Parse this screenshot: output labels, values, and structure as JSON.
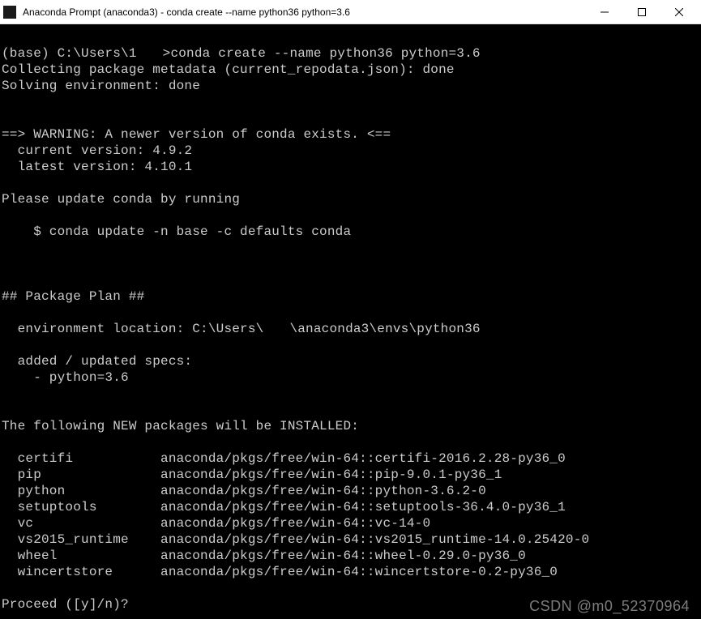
{
  "window": {
    "title": "Anaconda Prompt (anaconda3) - conda  create --name python36 python=3.6"
  },
  "prompt": {
    "prefix": "(base) C:\\Users\\1",
    "gt": ">",
    "command": "conda create --name python36 python=3.6"
  },
  "lines": {
    "collecting": "Collecting package metadata (current_repodata.json): done",
    "solving": "Solving environment: done",
    "warn_header": "==> WARNING: A newer version of conda exists. <==",
    "current_ver": "  current version: 4.9.2",
    "latest_ver": "  latest version: 4.10.1",
    "please_update": "Please update conda by running",
    "update_cmd": "    $ conda update -n base -c defaults conda",
    "plan_header": "## Package Plan ##",
    "env_loc_prefix": "  environment location: C:\\Users\\",
    "env_loc_suffix": "\\anaconda3\\envs\\python36",
    "added_specs": "  added / updated specs:",
    "spec1": "    - python=3.6",
    "new_pkg_header": "The following NEW packages will be INSTALLED:"
  },
  "packages": [
    {
      "name": "certifi",
      "spec": "anaconda/pkgs/free/win-64::certifi-2016.2.28-py36_0"
    },
    {
      "name": "pip",
      "spec": "anaconda/pkgs/free/win-64::pip-9.0.1-py36_1"
    },
    {
      "name": "python",
      "spec": "anaconda/pkgs/free/win-64::python-3.6.2-0"
    },
    {
      "name": "setuptools",
      "spec": "anaconda/pkgs/free/win-64::setuptools-36.4.0-py36_1"
    },
    {
      "name": "vc",
      "spec": "anaconda/pkgs/free/win-64::vc-14-0"
    },
    {
      "name": "vs2015_runtime",
      "spec": "anaconda/pkgs/free/win-64::vs2015_runtime-14.0.25420-0"
    },
    {
      "name": "wheel",
      "spec": "anaconda/pkgs/free/win-64::wheel-0.29.0-py36_0"
    },
    {
      "name": "wincertstore",
      "spec": "anaconda/pkgs/free/win-64::wincertstore-0.2-py36_0"
    }
  ],
  "proceed": "Proceed ([y]/n)?",
  "watermark": "CSDN @m0_52370964"
}
